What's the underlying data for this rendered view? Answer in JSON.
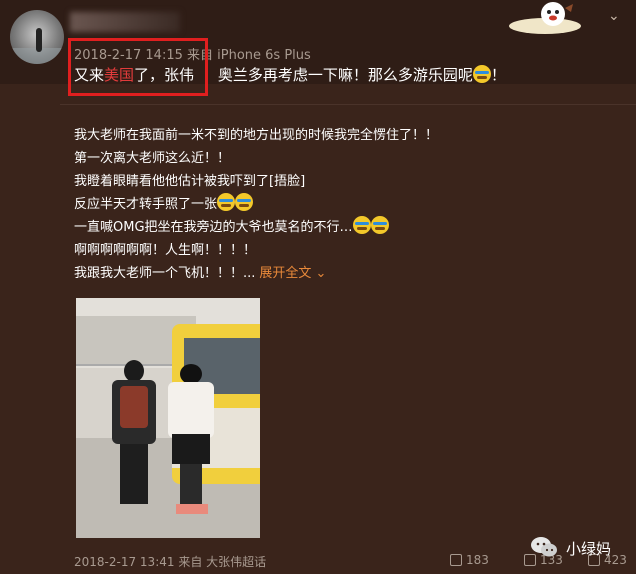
{
  "repost": {
    "timestamp": "2018-2-17 14:15",
    "source": "来自 iPhone 6s Plus",
    "text_pre": "又来",
    "text_highlight": "美国",
    "text_post": "了，张伟",
    "text_tail": "奥兰多再考虑一下嘛！那么多游乐园呢",
    "text_end": "！"
  },
  "original": {
    "lines": [
      "我大老师在我面前一米不到的地方出现的时候我完全愣住了！！",
      "第一次离大老师这么近！！",
      "我瞪着眼睛看他他估计被我吓到了[捂脸]",
      "反应半天才转手照了一张",
      "一直喊OMG把坐在我旁边的大爷也莫名的不行…",
      "啊啊啊啊啊啊！人生啊！！！！",
      "我跟我大老师一个飞机！！！..."
    ],
    "expand_label": "展开全文 ⌄"
  },
  "footer": {
    "timestamp": "2018-2-17 13:41",
    "source": "来自 大张伟超话",
    "reposts": "183",
    "comments": "133",
    "likes": "423"
  },
  "watermark": {
    "brand": "小绿妈"
  },
  "icons": {
    "caret": "chevron-down-icon",
    "repost": "repost-icon",
    "comment": "comment-icon",
    "like": "like-icon",
    "wechat": "wechat-icon"
  },
  "colors": {
    "background": "#3a241b",
    "highlight_box": "#e01f1f",
    "link": "#e8893a"
  }
}
